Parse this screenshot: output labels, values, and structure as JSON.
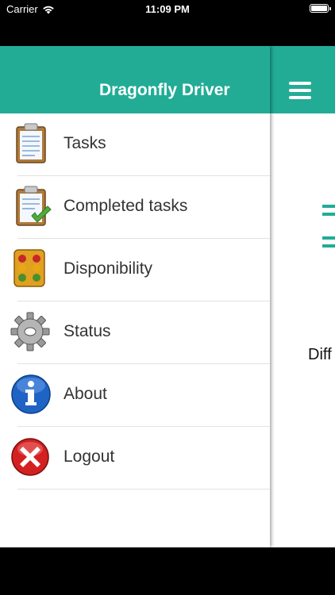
{
  "status_bar": {
    "carrier": "Carrier",
    "time": "11:09 PM"
  },
  "drawer": {
    "title": "Dragonfly Driver",
    "header_color": "#22ac96",
    "items": [
      {
        "label": "Tasks",
        "icon": "clipboard-icon"
      },
      {
        "label": "Completed tasks",
        "icon": "clipboard-check-icon"
      },
      {
        "label": "Disponibility",
        "icon": "traffic-light-icon"
      },
      {
        "label": "Status",
        "icon": "gear-icon"
      },
      {
        "label": "About",
        "icon": "info-icon"
      },
      {
        "label": "Logout",
        "icon": "close-icon"
      }
    ]
  },
  "main": {
    "menu_icon": "hamburger-menu-icon",
    "partial_text": "Diff"
  }
}
